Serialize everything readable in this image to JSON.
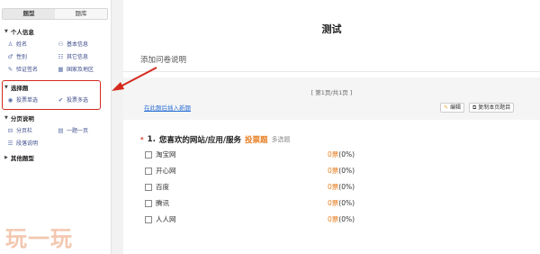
{
  "sidebar": {
    "tabs": [
      {
        "label": "题型",
        "active": true
      },
      {
        "label": "题库",
        "active": false
      }
    ],
    "groups": [
      {
        "title": "个人信息",
        "items": [
          "姓名",
          "基本信息",
          "性别",
          "其它信息",
          "验证签名",
          "国家及地区"
        ]
      },
      {
        "title": "选择题",
        "items": [
          "投票单选",
          "投票多选"
        ]
      },
      {
        "title": "分页说明",
        "items": [
          "分页栏",
          "一题一页",
          "段落说明"
        ]
      },
      {
        "title": "其他题型",
        "items": []
      }
    ]
  },
  "main": {
    "survey_title": "测试",
    "add_description": "添加问卷说明",
    "page_info": "[ 第1页/共1页 ]",
    "insert_link": "在此题后插入新题",
    "edit_button": "编辑",
    "copy_button": "复制本页题目",
    "question": {
      "required_mark": "*",
      "number": "1.",
      "text": "您喜欢的网站/应用/服务",
      "badge": "投票题",
      "type": "多选题",
      "options": [
        {
          "label": "淘宝网",
          "votes": "0票",
          "percent": "(0%)"
        },
        {
          "label": "开心网",
          "votes": "0票",
          "percent": "(0%)"
        },
        {
          "label": "百度",
          "votes": "0票",
          "percent": "(0%)"
        },
        {
          "label": "腾讯",
          "votes": "0票",
          "percent": "(0%)"
        },
        {
          "label": "人人网",
          "votes": "0票",
          "percent": "(0%)"
        }
      ]
    }
  },
  "watermark": "玩一玩",
  "colors": {
    "highlight": "#d42a1e",
    "accent": "#e67e22",
    "link": "#2a6fd6"
  }
}
